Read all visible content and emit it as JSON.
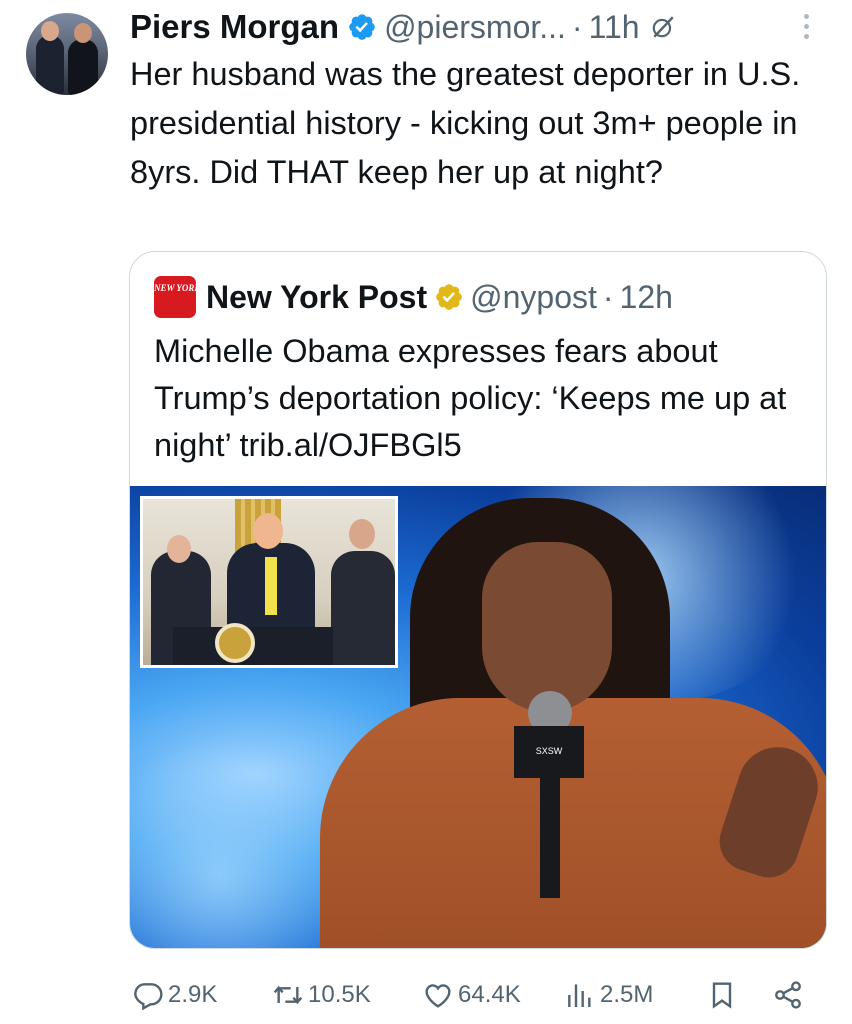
{
  "tweet": {
    "author_name": "Piers Morgan",
    "handle": "@piersmor...",
    "separator": "·",
    "time": "11h",
    "text": "Her husband was the greatest deporter in U.S. presidential history - kicking out 3m+ people in 8yrs. Did THAT keep her up at night?",
    "verified_badge_icon": "blue-verified-badge-icon",
    "grok_icon": "grok-icon",
    "more_icon": "more-vertical-icon"
  },
  "quote": {
    "logo_text": "NEW YORK POST",
    "author_name": "New York Post",
    "handle": "@nypost",
    "separator": "·",
    "time": "12h",
    "text": "Michelle Obama expresses fears about Trump’s deportation policy: ‘Keeps me up at night’ trib.al/OJFBGl5",
    "verified_badge_icon": "gold-verified-badge-icon",
    "mic_label": "SXSW"
  },
  "actions": {
    "replies": "2.9K",
    "reposts": "10.5K",
    "likes": "64.4K",
    "views": "2.5M"
  },
  "colors": {
    "text": "#0f1419",
    "muted": "#536471",
    "verified_blue": "#1d9bf0",
    "verified_gold": "#e2b719",
    "border": "#cfd9de",
    "nypost_red": "#d71920"
  }
}
